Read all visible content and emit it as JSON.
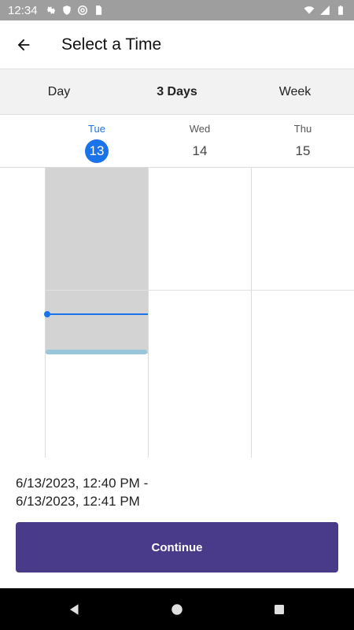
{
  "status_bar": {
    "time": "12:34",
    "icons_left": [
      "gear-icon",
      "shield-icon",
      "at-sign-icon",
      "sim-card-icon"
    ],
    "icons_right": [
      "wifi-icon",
      "signal-icon",
      "battery-icon"
    ]
  },
  "app_bar": {
    "back_icon": "arrow-left-icon",
    "title": "Select a Time"
  },
  "view_tabs": {
    "items": [
      {
        "label": "Day",
        "active": false
      },
      {
        "label": "3 Days",
        "active": true
      },
      {
        "label": "Week",
        "active": false
      }
    ]
  },
  "days": [
    {
      "name": "Tue",
      "number": "13",
      "today": true
    },
    {
      "name": "Wed",
      "number": "14",
      "today": false
    },
    {
      "name": "Thu",
      "number": "15",
      "today": false
    }
  ],
  "selection": {
    "start_text": "6/13/2023, 12:40 PM -",
    "end_text": "6/13/2023, 12:41 PM"
  },
  "actions": {
    "continue_label": "Continue"
  },
  "colors": {
    "accent_blue": "#1a73e8",
    "primary_button": "#4a3a8a",
    "selection_fill": "#d3d3d3",
    "selection_handle": "#9ac6d9"
  },
  "nav_bar": {
    "items": [
      "back-triangle-icon",
      "home-circle-icon",
      "recents-square-icon"
    ]
  }
}
